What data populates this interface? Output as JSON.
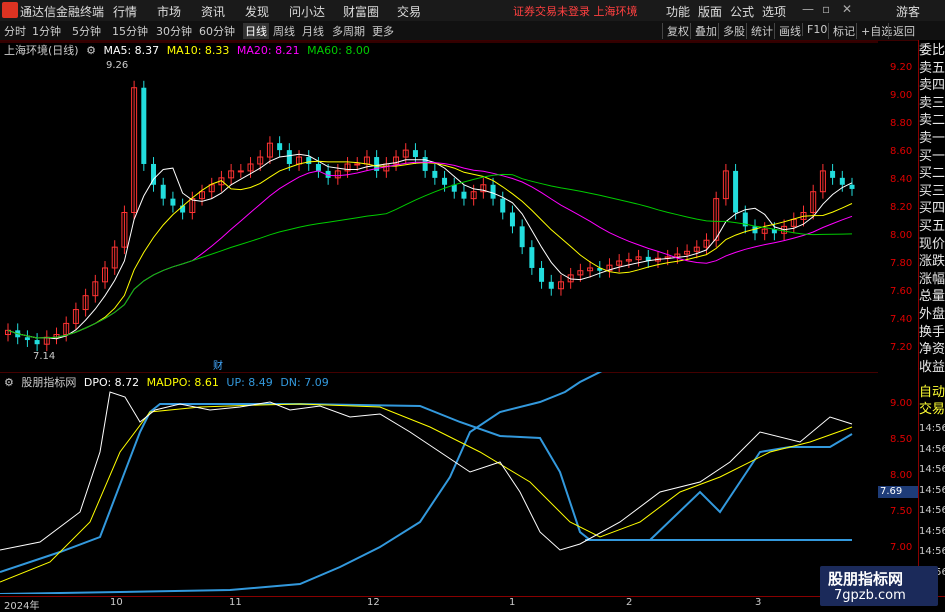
{
  "app": {
    "title": "通达信金融终端",
    "menu": [
      "行情",
      "市场",
      "资讯",
      "发现",
      "问小达",
      "财富圈",
      "交易"
    ],
    "status_note": "证券交易未登录  上海环境",
    "right_menu": [
      "功能",
      "版面",
      "公式",
      "选项"
    ],
    "guest": "游客"
  },
  "toolbar": {
    "periods": [
      "分时",
      "1分钟",
      "5分钟",
      "15分钟",
      "30分钟",
      "60分钟",
      "日线",
      "周线",
      "月线",
      "多周期",
      "更多"
    ],
    "active_period": "日线",
    "right_buttons": [
      "复权",
      "叠加",
      "多股",
      "统计",
      "画线",
      "F10",
      "标记",
      "+自选",
      "返回"
    ]
  },
  "main_chart": {
    "stock": "上海环境(日线)",
    "ma_legend": [
      {
        "label": "MA5: 8.37",
        "color": "#ffffff"
      },
      {
        "label": "MA10: 8.33",
        "color": "#ffff00"
      },
      {
        "label": "MA20: 8.21",
        "color": "#ff00ff"
      },
      {
        "label": "MA60: 8.00",
        "color": "#00cc00"
      }
    ],
    "high_marker": "9.26",
    "low_marker": "7.14",
    "event_marker": "财",
    "price_ticks": [
      "9.20",
      "9.00",
      "8.80",
      "8.60",
      "8.40",
      "8.20",
      "8.00",
      "7.80",
      "7.60",
      "7.40",
      "7.20"
    ]
  },
  "sub_chart": {
    "name": "股朋指标网",
    "legend": [
      {
        "label": "DPO: 8.72",
        "color": "#ffffff"
      },
      {
        "label": "MADPO: 8.61",
        "color": "#ffff00"
      },
      {
        "label": "UP: 8.49",
        "color": "#3399dd"
      },
      {
        "label": "DN: 7.09",
        "color": "#3399dd"
      }
    ],
    "ticks": [
      "9.00",
      "8.50",
      "8.00",
      "7.50",
      "7.00"
    ],
    "current_value": "7.69"
  },
  "x_axis": {
    "labels": [
      "2024年",
      "10",
      "11",
      "12",
      "1",
      "2",
      "3"
    ]
  },
  "right_panel": {
    "items": [
      "委比",
      "卖五",
      "卖四",
      "卖三",
      "卖二",
      "卖一",
      "买一",
      "买二",
      "买三",
      "买四",
      "买五",
      "现价",
      "涨跌",
      "涨幅",
      "总量",
      "外盘",
      "换手",
      "净资",
      "收益"
    ],
    "auto_label": "自动",
    "trade_label": "交易",
    "times": [
      "14:56",
      "14:56",
      "14:56",
      "14:56",
      "14:56",
      "14:56",
      "14:56",
      "14:56"
    ]
  },
  "watermark": {
    "line1": "股朋指标网",
    "line2": "7gpzb.com"
  },
  "colors": {
    "up_candle": "#ff3333",
    "down_candle": "#22dddd",
    "ma5": "#ffffff",
    "ma10": "#ffff00",
    "ma20": "#ff00ff",
    "ma60": "#00cc00",
    "band": "#3399dd"
  },
  "chart_data": {
    "type": "line",
    "candles_close": [
      7.35,
      7.3,
      7.28,
      7.25,
      7.3,
      7.32,
      7.4,
      7.5,
      7.6,
      7.7,
      7.8,
      7.95,
      8.2,
      9.1,
      8.55,
      8.4,
      8.3,
      8.25,
      8.2,
      8.3,
      8.35,
      8.4,
      8.45,
      8.5,
      8.5,
      8.55,
      8.6,
      8.7,
      8.65,
      8.55,
      8.6,
      8.55,
      8.5,
      8.45,
      8.5,
      8.55,
      8.55,
      8.6,
      8.5,
      8.55,
      8.6,
      8.65,
      8.6,
      8.5,
      8.45,
      8.4,
      8.35,
      8.3,
      8.35,
      8.4,
      8.3,
      8.2,
      8.1,
      7.95,
      7.8,
      7.7,
      7.65,
      7.7,
      7.75,
      7.78,
      7.8,
      7.78,
      7.82,
      7.85,
      7.86,
      7.88,
      7.85,
      7.87,
      7.88,
      7.9,
      7.92,
      7.95,
      8.0,
      8.3,
      8.5,
      8.2,
      8.1,
      8.05,
      8.08,
      8.05,
      8.1,
      8.15,
      8.2,
      8.35,
      8.5,
      8.45,
      8.4,
      8.37
    ]
  }
}
